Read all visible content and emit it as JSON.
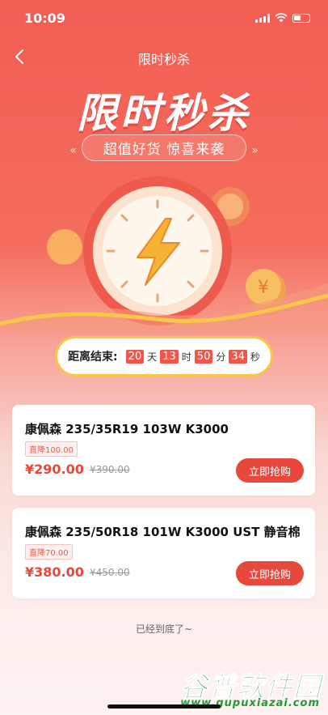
{
  "status_bar": {
    "time": "10:09"
  },
  "nav": {
    "title": "限时秒杀"
  },
  "hero": {
    "title": "限时秒杀",
    "subtitle": "超值好货 惊喜来袭"
  },
  "countdown": {
    "label": "距离结束:",
    "days": "20",
    "days_unit": "天",
    "hours": "13",
    "hours_unit": "时",
    "minutes": "50",
    "minutes_unit": "分",
    "seconds": "34",
    "seconds_unit": "秒"
  },
  "products": [
    {
      "name": "康佩森 235/35R19 103W K3000",
      "discount": "直降100.00",
      "price": "¥290.00",
      "original_price": "¥390.00",
      "buy_label": "立即抢购"
    },
    {
      "name": "康佩森 235/50R18 101W K3000 UST 静音棉",
      "discount": "直降70.00",
      "price": "¥380.00",
      "original_price": "¥450.00",
      "buy_label": "立即抢购"
    }
  ],
  "footer": {
    "end_text": "已经到底了~"
  },
  "watermark": {
    "name": "谷普软件园",
    "url": "www.gupuxiazai.com"
  },
  "colors": {
    "accent": "#e8473b",
    "gold": "#f7c64b",
    "watermark_green": "#1f9b3a"
  }
}
